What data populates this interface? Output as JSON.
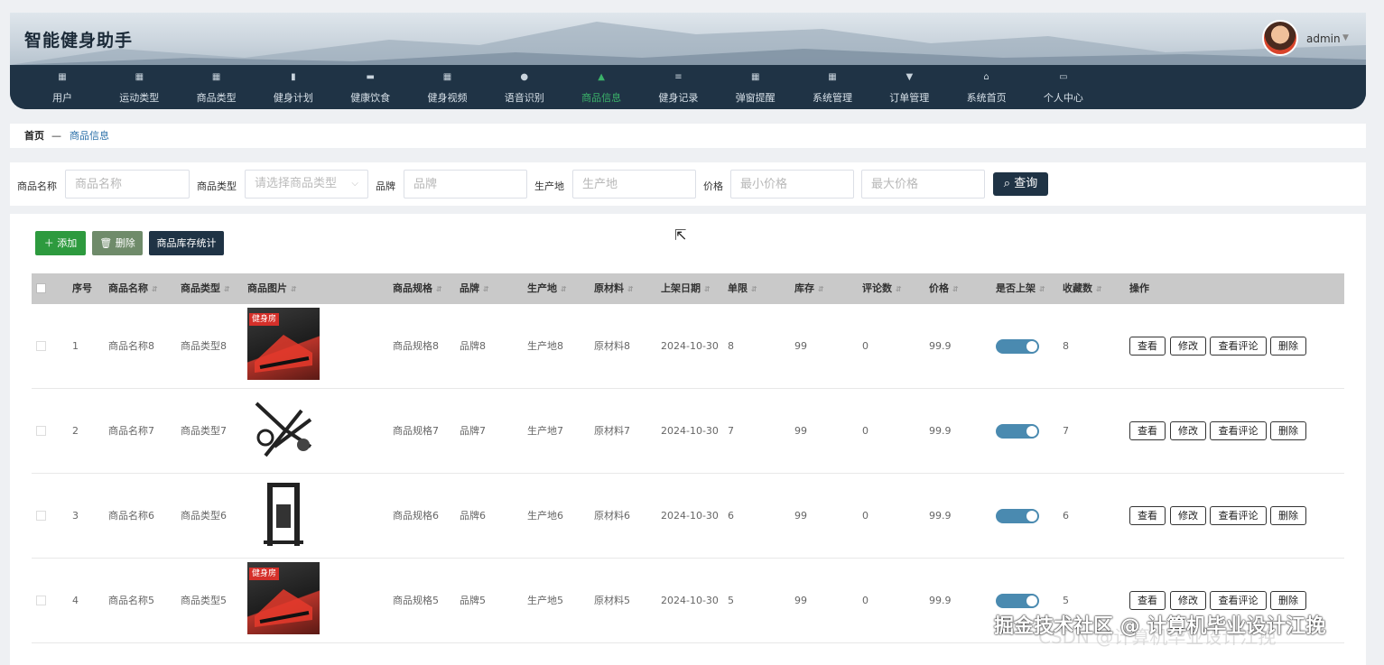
{
  "app": {
    "title": "智能健身助手",
    "user": "admin"
  },
  "nav": [
    {
      "label": "用户",
      "icon": "grid-icon"
    },
    {
      "label": "运动类型",
      "icon": "grid-icon"
    },
    {
      "label": "商品类型",
      "icon": "grid-icon"
    },
    {
      "label": "健身计划",
      "icon": "bar-chart-icon"
    },
    {
      "label": "健康饮食",
      "icon": "chat-icon"
    },
    {
      "label": "健身视频",
      "icon": "grid-icon"
    },
    {
      "label": "语音识别",
      "icon": "user-icon"
    },
    {
      "label": "商品信息",
      "icon": "bag-icon",
      "active": true
    },
    {
      "label": "健身记录",
      "icon": "sliders-icon"
    },
    {
      "label": "弹窗提醒",
      "icon": "grid-icon"
    },
    {
      "label": "系统管理",
      "icon": "grid-icon"
    },
    {
      "label": "订单管理",
      "icon": "flag-icon"
    },
    {
      "label": "系统首页",
      "icon": "home-icon"
    },
    {
      "label": "个人中心",
      "icon": "card-icon"
    }
  ],
  "breadcrumb": {
    "home": "首页",
    "sep": "—",
    "current": "商品信息"
  },
  "search": {
    "name_label": "商品名称",
    "name_placeholder": "商品名称",
    "type_label": "商品类型",
    "type_placeholder": "请选择商品类型",
    "brand_label": "品牌",
    "brand_placeholder": "品牌",
    "origin_label": "生产地",
    "origin_placeholder": "生产地",
    "price_label": "价格",
    "min_placeholder": "最小价格",
    "max_placeholder": "最大价格",
    "query": "查询"
  },
  "toolbar": {
    "add": "添加",
    "delete": "删除",
    "stats": "商品库存统计"
  },
  "table": {
    "headers": [
      "序号",
      "商品名称",
      "商品类型",
      "商品图片",
      "商品规格",
      "品牌",
      "生产地",
      "原材料",
      "上架日期",
      "单限",
      "库存",
      "评论数",
      "价格",
      "是否上架",
      "收藏数",
      "操作"
    ],
    "actions": [
      "查看",
      "修改",
      "查看评论",
      "删除"
    ],
    "rows": [
      {
        "no": "1",
        "name": "商品名称8",
        "type": "商品类型8",
        "image_tag": "健身房",
        "spec": "商品规格8",
        "brand": "品牌8",
        "origin": "生产地8",
        "material": "原材料8",
        "date": "2024-10-30",
        "limit": "8",
        "stock": "99",
        "comments": "0",
        "price": "99.9",
        "on_shelf": true,
        "favorites": "8"
      },
      {
        "no": "2",
        "name": "商品名称7",
        "type": "商品类型7",
        "image_tag": "",
        "spec": "商品规格7",
        "brand": "品牌7",
        "origin": "生产地7",
        "material": "原材料7",
        "date": "2024-10-30",
        "limit": "7",
        "stock": "99",
        "comments": "0",
        "price": "99.9",
        "on_shelf": true,
        "favorites": "7"
      },
      {
        "no": "3",
        "name": "商品名称6",
        "type": "商品类型6",
        "image_tag": "",
        "spec": "商品规格6",
        "brand": "品牌6",
        "origin": "生产地6",
        "material": "原材料6",
        "date": "2024-10-30",
        "limit": "6",
        "stock": "99",
        "comments": "0",
        "price": "99.9",
        "on_shelf": true,
        "favorites": "6"
      },
      {
        "no": "4",
        "name": "商品名称5",
        "type": "商品类型5",
        "image_tag": "健身房",
        "spec": "商品规格5",
        "brand": "品牌5",
        "origin": "生产地5",
        "material": "原材料5",
        "date": "2024-10-30",
        "limit": "5",
        "stock": "99",
        "comments": "0",
        "price": "99.9",
        "on_shelf": true,
        "favorites": "5"
      }
    ]
  },
  "watermark": "掘金技术社区 @ 计算机毕业设计江挽",
  "watermark2": "CSDN @计算机毕业设计江挽",
  "colors": {
    "nav_bg": "#1f3345",
    "active": "#3bb36a",
    "switch": "#4a8ab0",
    "add": "#2d9a3e"
  }
}
